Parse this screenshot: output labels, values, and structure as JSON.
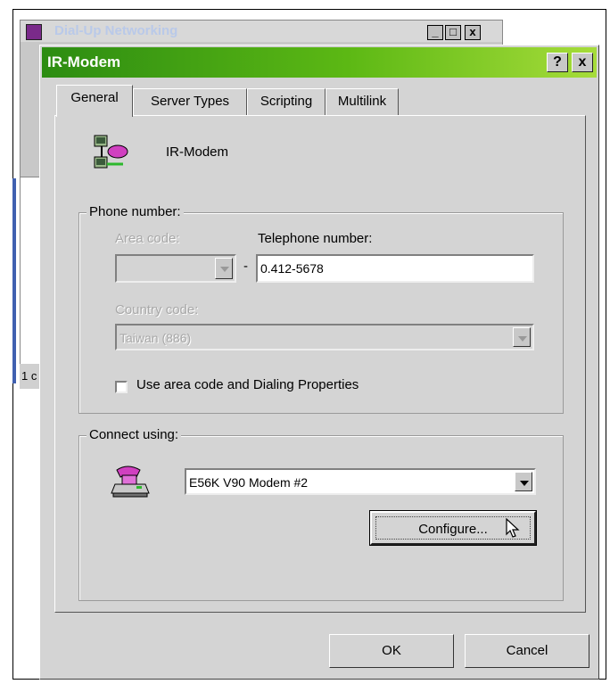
{
  "background_window": {
    "title": "Dial-Up Networking",
    "minimize_glyph": "_",
    "maximize_glyph": "□",
    "close_glyph": "x",
    "status_fragment": "1 c"
  },
  "dialog": {
    "title": "IR-Modem",
    "help_glyph": "?",
    "close_glyph": "x",
    "tabs": [
      {
        "label": "General",
        "active": true
      },
      {
        "label": "Server Types",
        "active": false
      },
      {
        "label": "Scripting",
        "active": false
      },
      {
        "label": "Multilink",
        "active": false
      }
    ],
    "connection_name": "IR-Modem",
    "phone_group": {
      "legend": "Phone number:",
      "area_code_label": "Area code:",
      "area_code_value": "",
      "dash": "-",
      "telephone_label": "Telephone number:",
      "telephone_value": "0.412-5678",
      "country_label": "Country code:",
      "country_value": "Taiwan (886)",
      "use_area_code_label": "Use area code and Dialing Properties",
      "use_area_code_checked": false
    },
    "connect_group": {
      "legend": "Connect using:",
      "device_value": "E56K V90 Modem #2",
      "configure_label": "Configure..."
    },
    "ok_label": "OK",
    "cancel_label": "Cancel"
  },
  "colors": {
    "titlebar_start": "#2c8c12",
    "titlebar_end": "#a6dc3a",
    "face": "#d4d4d4"
  }
}
